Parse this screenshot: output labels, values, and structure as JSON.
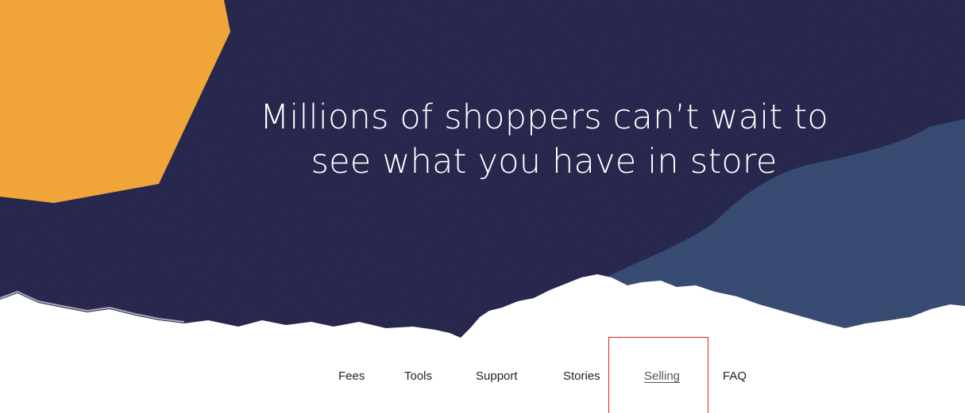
{
  "hero": {
    "headline_line1": "Millions of shoppers can’t wait to",
    "headline_line2": "see what you have in store",
    "colors": {
      "background": "#23224a",
      "orange_shape": "#f3a535",
      "blue_shape": "#33476f",
      "paper": "#ffffff"
    }
  },
  "nav": {
    "items": [
      {
        "label": "Fees"
      },
      {
        "label": "Tools"
      },
      {
        "label": "Support"
      },
      {
        "label": "Stories"
      },
      {
        "label": "Selling",
        "active": true
      },
      {
        "label": "FAQ"
      }
    ]
  },
  "highlight": {
    "color": "#e02020",
    "target": "Selling"
  }
}
